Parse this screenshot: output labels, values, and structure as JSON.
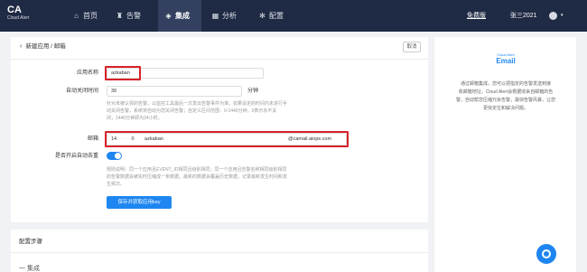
{
  "brand": {
    "logo": "CA",
    "logo_sub": "Cloud Alert"
  },
  "nav": {
    "home": "首页",
    "alert": "告警",
    "integrate": "集成",
    "analysis": "分析",
    "config": "配置"
  },
  "header": {
    "free_tier": "免费版",
    "user": "张三2021",
    "caret": "▾"
  },
  "form": {
    "breadcrumb": "新建应用 / 邮箱",
    "cancel": "取消",
    "app_name_label": "应用名称",
    "app_name_value": "azkaban",
    "autoclose_label": "自动关闭时间",
    "autoclose_value": "30",
    "autoclose_unit": "分钟",
    "autoclose_hint1": "针对未被认领的告警，以监控工具最后一次发出告警事件为准，如果设定的时间内未进行手",
    "autoclose_hint2": "动关闭告警，系统将自动为您关闭告警；自定义区间范围：0-1440分钟，0表示永不关",
    "autoclose_hint3": "闭，1440分钟即为24小时。",
    "email_label": "邮箱",
    "email_prefix": "14",
    "email_blur": "·······",
    "email_suffix_num": "0",
    "email_name": "azkaban",
    "email_domain": "@camail.aiops.com",
    "dedup_label": "是否开启自动去重",
    "dedup_hint1": "规则说明：同一个应用且EVENT_ID相同且级别相同；同一个应用且告警名称相同级别相同",
    "dedup_hint2": "的告警数据会被实时压缩成一条数据。最新的数据会覆盖历史数据，记录最新发生时间和发",
    "dedup_hint3": "生频次。",
    "save": "保存并获取应用key"
  },
  "steps": {
    "title": "配置步骤",
    "step1": "一  集成"
  },
  "side": {
    "logo_top": "Cloud Alert",
    "logo_main": "Email",
    "desc1": "通过邮箱集成，您可以把指定的告警发送到接",
    "desc2": "收邮箱地址，Cloud Alert会根据收来自邮箱的告",
    "desc3": "警，自动帮您压缩冗余告警，最快告警风暴，让您",
    "desc4": "更快定位和解决问题。"
  }
}
